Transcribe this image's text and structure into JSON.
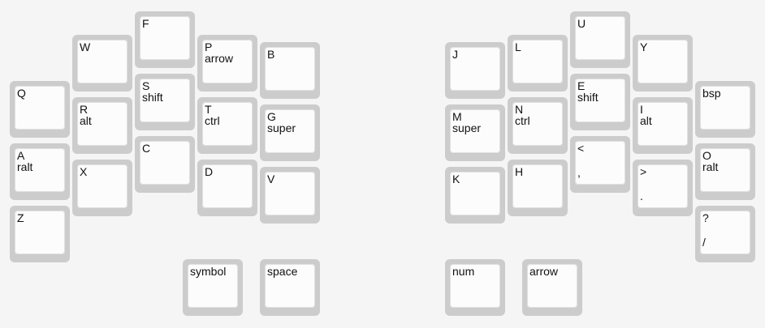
{
  "left_hand": {
    "keys": [
      {
        "id": "q",
        "top": "Q",
        "sub": "",
        "bottom": ""
      },
      {
        "id": "a",
        "top": "A",
        "sub": "ralt",
        "bottom": ""
      },
      {
        "id": "z",
        "top": "Z",
        "sub": "",
        "bottom": ""
      },
      {
        "id": "w",
        "top": "W",
        "sub": "",
        "bottom": ""
      },
      {
        "id": "r",
        "top": "R",
        "sub": "alt",
        "bottom": ""
      },
      {
        "id": "x",
        "top": "X",
        "sub": "",
        "bottom": ""
      },
      {
        "id": "f",
        "top": "F",
        "sub": "",
        "bottom": ""
      },
      {
        "id": "s",
        "top": "S",
        "sub": "shift",
        "bottom": ""
      },
      {
        "id": "c",
        "top": "C",
        "sub": "",
        "bottom": ""
      },
      {
        "id": "p",
        "top": "P",
        "sub": "arrow",
        "bottom": ""
      },
      {
        "id": "t",
        "top": "T",
        "sub": "ctrl",
        "bottom": ""
      },
      {
        "id": "d",
        "top": "D",
        "sub": "",
        "bottom": ""
      },
      {
        "id": "b",
        "top": "B",
        "sub": "",
        "bottom": ""
      },
      {
        "id": "g",
        "top": "G",
        "sub": "super",
        "bottom": ""
      },
      {
        "id": "v",
        "top": "V",
        "sub": "",
        "bottom": ""
      },
      {
        "id": "symbol",
        "top": "symbol",
        "sub": "",
        "bottom": ""
      },
      {
        "id": "space",
        "top": "space",
        "sub": "",
        "bottom": ""
      }
    ]
  },
  "right_hand": {
    "keys": [
      {
        "id": "j",
        "top": "J",
        "sub": "",
        "bottom": ""
      },
      {
        "id": "m",
        "top": "M",
        "sub": "super",
        "bottom": ""
      },
      {
        "id": "k",
        "top": "K",
        "sub": "",
        "bottom": ""
      },
      {
        "id": "l",
        "top": "L",
        "sub": "",
        "bottom": ""
      },
      {
        "id": "n",
        "top": "N",
        "sub": "ctrl",
        "bottom": ""
      },
      {
        "id": "h",
        "top": "H",
        "sub": "",
        "bottom": ""
      },
      {
        "id": "u",
        "top": "U",
        "sub": "",
        "bottom": ""
      },
      {
        "id": "e",
        "top": "E",
        "sub": "shift",
        "bottom": ""
      },
      {
        "id": "comma",
        "top": "<",
        "sub": "",
        "bottom": ","
      },
      {
        "id": "y",
        "top": "Y",
        "sub": "",
        "bottom": ""
      },
      {
        "id": "i",
        "top": "I",
        "sub": "alt",
        "bottom": ""
      },
      {
        "id": "period",
        "top": ">",
        "sub": "",
        "bottom": "."
      },
      {
        "id": "bsp",
        "top": "bsp",
        "sub": "",
        "bottom": ""
      },
      {
        "id": "o",
        "top": "O",
        "sub": "ralt",
        "bottom": ""
      },
      {
        "id": "slash",
        "top": "?",
        "sub": "",
        "bottom": "/"
      },
      {
        "id": "num",
        "top": "num",
        "sub": "",
        "bottom": ""
      },
      {
        "id": "arrow",
        "top": "arrow",
        "sub": "",
        "bottom": ""
      }
    ]
  }
}
